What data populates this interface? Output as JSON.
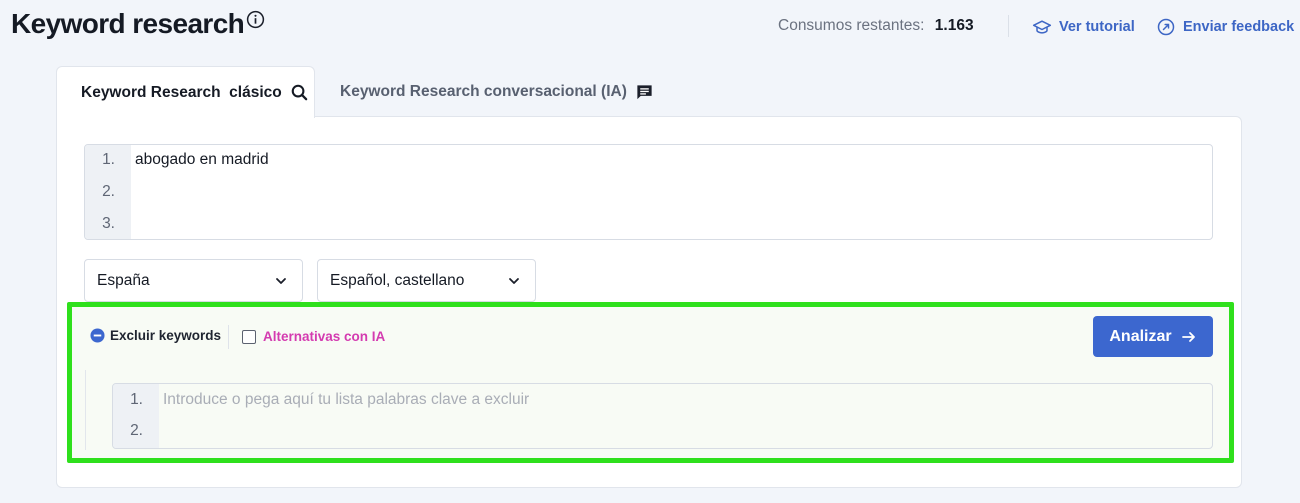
{
  "header": {
    "title": "Keyword research",
    "info_icon": "info-circle-icon",
    "consumos_label": "Consumos restantes:",
    "consumos_value": "1.163",
    "tutorial_label": "Ver tutorial",
    "tutorial_icon": "graduation-cap-icon",
    "feedback_label": "Enviar feedback",
    "feedback_icon": "feedback-send-icon",
    "accent_color": "#3d66c5"
  },
  "tabs": [
    {
      "label": "Keyword Research  clásico",
      "icon": "search-icon",
      "active": true
    },
    {
      "label": "Keyword Research conversacional (IA)",
      "icon": "chat-icon",
      "active": false
    }
  ],
  "keywords_editor": {
    "line_numbers": [
      "1.",
      "2.",
      "3."
    ],
    "lines": [
      "abogado en madrid",
      "",
      ""
    ]
  },
  "selects": {
    "country": "España",
    "language": "Español, castellano"
  },
  "exclusion": {
    "toggle_label": "Excluir keywords",
    "toggle_icon": "minus-circle-icon",
    "alt_label": "Alternativas con IA",
    "alt_checked": false,
    "analizar_label": "Analizar",
    "analizar_icon": "arrow-right-icon",
    "editor_line_numbers": [
      "1.",
      "2."
    ],
    "editor_placeholder": "Introduce o pega aquí tu lista palabras clave a excluir",
    "highlight_color": "#2fe01c"
  }
}
